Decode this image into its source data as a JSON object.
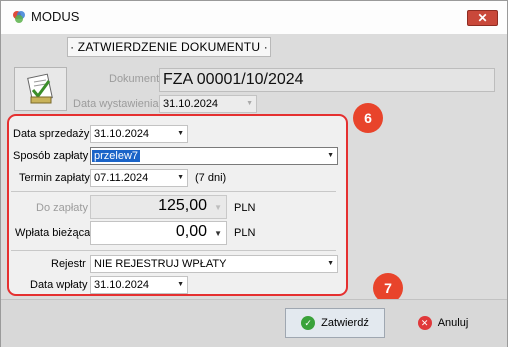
{
  "window": {
    "title": "MODUS",
    "close_label": "✕"
  },
  "header": {
    "section_title": "· ZATWIERDZENIE DOKUMENTU ·"
  },
  "document": {
    "label": "Dokument",
    "number": "FZA 00001/10/2024",
    "issue_date_label": "Data wystawienia",
    "issue_date": "31.10.2024"
  },
  "form": {
    "sale_date_label": "Data sprzedaży",
    "sale_date": "31.10.2024",
    "payment_method_label": "Sposób zapłaty",
    "payment_method": "przelew7",
    "payment_term_label": "Termin zapłaty",
    "payment_term": "07.11.2024",
    "payment_term_days": "(7 dni)",
    "to_pay_label": "Do zapłaty",
    "to_pay_value": "125,00",
    "to_pay_currency": "PLN",
    "current_payment_label": "Wpłata bieżąca",
    "current_payment_value": "0,00",
    "current_payment_currency": "PLN",
    "register_label": "Rejestr",
    "register_value": "NIE REJESTRUJ WPŁATY",
    "payment_date_label": "Data wpłaty",
    "payment_date": "31.10.2024"
  },
  "badges": {
    "first": "6",
    "second": "7"
  },
  "footer": {
    "confirm_label": "Zatwierdź",
    "cancel_label": "Anuluj"
  },
  "colors": {
    "highlight_border": "#e53030",
    "badge": "#e8442b",
    "selection": "#1b64c8"
  }
}
